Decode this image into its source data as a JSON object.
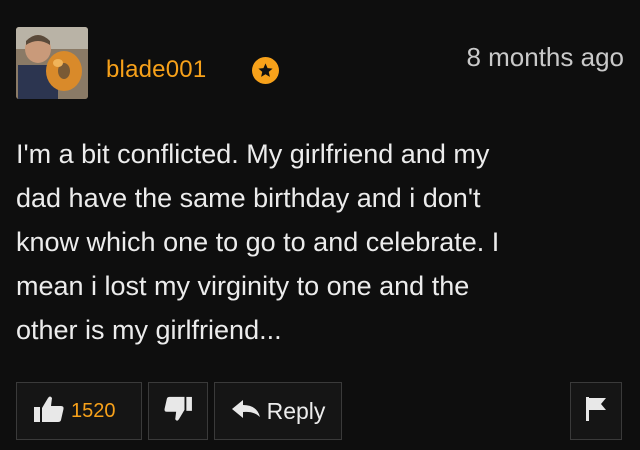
{
  "comment": {
    "username": "blade001",
    "badge_icon": "star-icon",
    "timestamp": "8 months ago",
    "lines": [
      "I'm a bit conflicted. My girlfriend and my",
      "dad have the same birthday and i don't",
      "know which one to go to and celebrate. I",
      "mean i lost my virginity to one and the",
      "other is my girlfriend..."
    ]
  },
  "actions": {
    "like_icon": "thumbs-up-icon",
    "like_count": "1520",
    "dislike_icon": "thumbs-down-icon",
    "reply_icon": "reply-arrow-icon",
    "reply_label": "Reply",
    "flag_icon": "flag-icon"
  },
  "colors": {
    "background": "#0e0e0e",
    "accent": "#f7a11a",
    "text": "#ececec",
    "button_border": "#3a3a3a"
  }
}
